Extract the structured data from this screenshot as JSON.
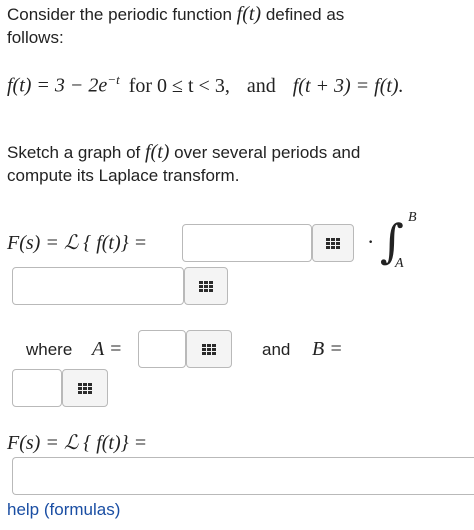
{
  "intro": {
    "line1": "Consider the periodic function",
    "line1_fn": "f(t)",
    "line1_end": "defined as",
    "line2": "follows:"
  },
  "definition": {
    "lhs": "f(t) = 3 − 2e",
    "exponent": "−t",
    "condition": "for 0 ≤ t < 3,",
    "and_word": "and",
    "periodicity": "f(t + 3) = f(t)."
  },
  "task": {
    "line1_start": "Sketch a graph of",
    "line1_fn": "f(t)",
    "line1_end": "over several periods and",
    "line2": "compute its Laplace transform."
  },
  "laplace_row": {
    "label": "F(s) = ℒ { f(t)} =",
    "dot": "·",
    "integral_symbol": "∫",
    "upper_limit": "B",
    "lower_limit": "A"
  },
  "limits_row": {
    "where_word": "where",
    "a_label": "A =",
    "and_word": "and",
    "b_label": "B ="
  },
  "final_row": {
    "label": "F(s) = ℒ { f(t)} ="
  },
  "inputs": {
    "factor_value": "",
    "integrand_value": "",
    "a_value": "",
    "b_value": "",
    "final_value": ""
  },
  "icons": {
    "palette": "grid-icon"
  },
  "help": {
    "label": "help (formulas)"
  },
  "colors": {
    "link": "#1a4ea3",
    "field_border": "#b9b9b9",
    "palette_bg": "#f4f4f4"
  }
}
